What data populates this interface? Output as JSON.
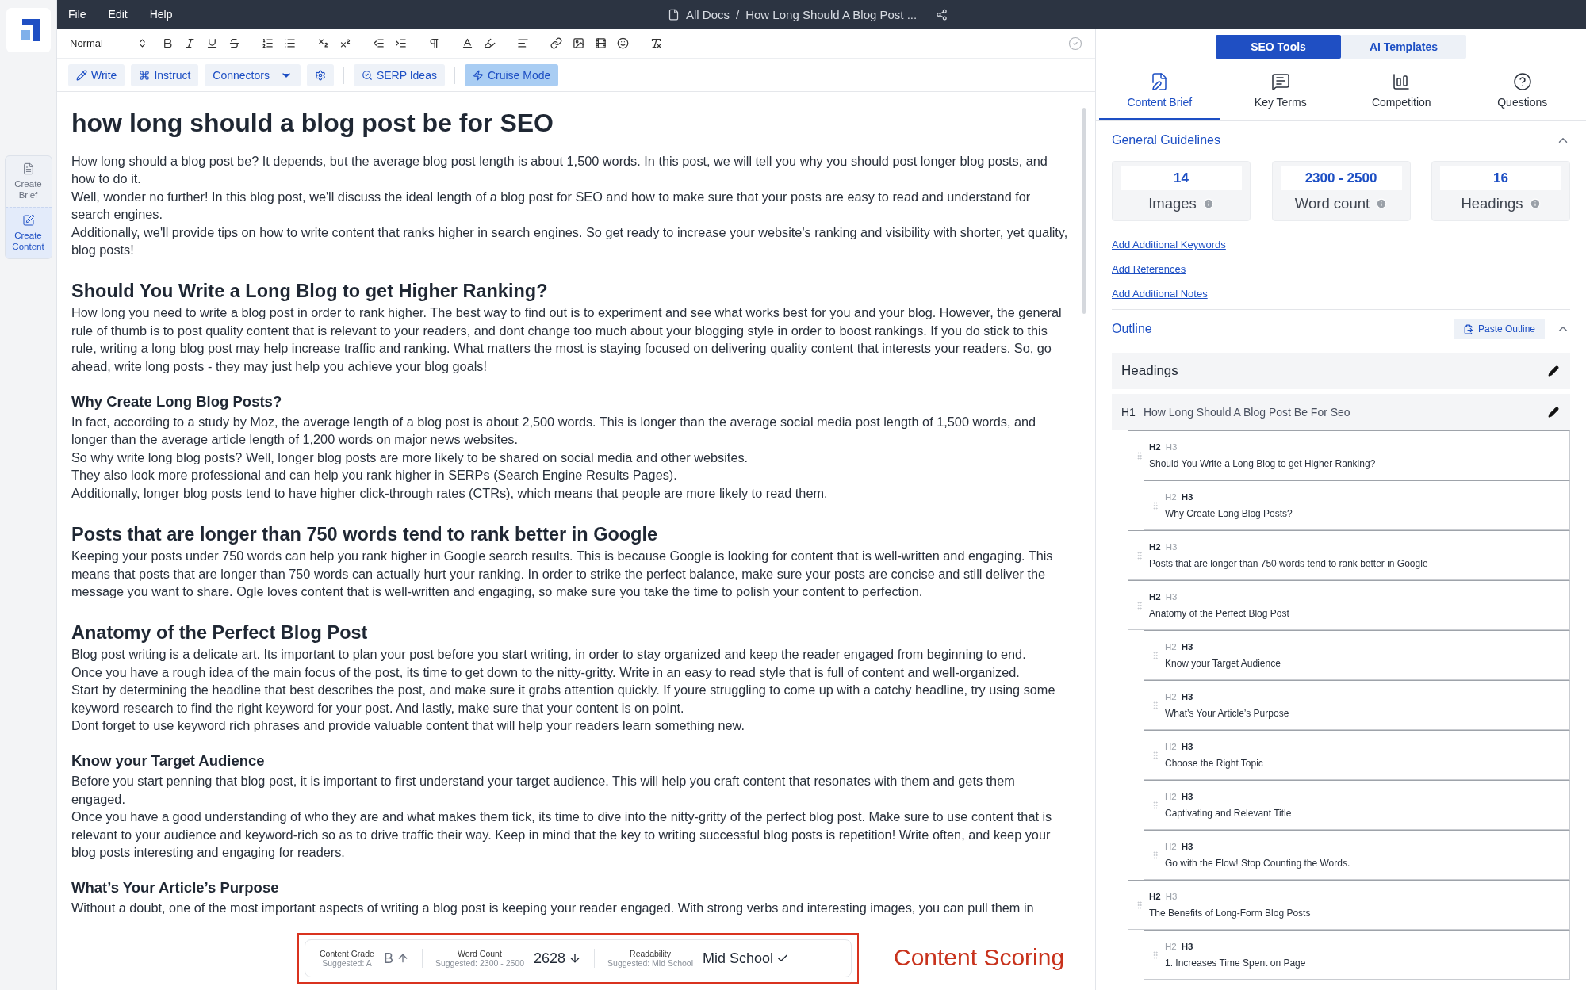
{
  "sidebar": {
    "items": [
      {
        "label": "Create Brief",
        "selected": false
      },
      {
        "label": "Create Content",
        "selected": true
      }
    ]
  },
  "menu": [
    "File",
    "Edit",
    "Help"
  ],
  "breadcrumb": {
    "root": "All Docs",
    "separator": "/",
    "title": "How Long Should A Blog Post ..."
  },
  "toolbar": {
    "style_select": "Normal"
  },
  "actions": [
    {
      "kind": "write",
      "label": "Write",
      "active": false
    },
    {
      "kind": "instruct",
      "label": "Instruct",
      "active": false
    },
    {
      "kind": "connectors",
      "label": "Connectors",
      "active": false
    },
    {
      "kind": "settings",
      "active": false
    },
    {
      "kind": "serp",
      "label": "SERP Ideas",
      "active": false
    },
    {
      "kind": "cruise",
      "label": "Cruise Mode",
      "active": true
    }
  ],
  "document": [
    {
      "kind": "title",
      "text": "how long should a blog post be for SEO"
    },
    {
      "kind": "p",
      "text": "How long should a blog post be? It depends, but the average blog post length is about 1,500 words. In this post, we will tell you why you should post longer blog posts, and how to do it."
    },
    {
      "kind": "p",
      "text": "Well, wonder no further! In this blog post, we'll discuss the ideal length of a blog post for SEO and how to make sure that your posts are easy to read and understand for search engines."
    },
    {
      "kind": "p",
      "text": "Additionally, we'll provide tips on how to write content that ranks higher in search engines. So get ready to increase your website's ranking and visibility with shorter, yet quality, blog posts!"
    },
    {
      "kind": "h2",
      "text": "Should You Write a Long Blog to get Higher Ranking?"
    },
    {
      "kind": "p",
      "text": "How long you need to write a blog post in order to rank higher. The best way to find out is to experiment and see what works best for you and your blog. However, the general rule of thumb is to post quality content that is relevant to your readers, and dont change too much about your blogging style in order to boost rankings. If you do stick to this rule, writing a long blog post may help increase traffic and ranking. What matters the most is staying focused on delivering quality content that interests your readers. So, go ahead, write long posts - they may just help you achieve your blog goals!"
    },
    {
      "kind": "h3",
      "text": "Why Create Long Blog Posts?"
    },
    {
      "kind": "p",
      "text": "In fact, according to a study by Moz, the average length of a blog post is about 2,500 words. This is longer than the average social media post length of 1,500 words, and longer than the average article length of 1,200 words on major news websites."
    },
    {
      "kind": "p",
      "text": "So why write long blog posts? Well, longer blog posts are more likely to be shared on social media and other websites."
    },
    {
      "kind": "p",
      "text": "They also look more professional and can help you rank higher in SERPs (Search Engine Results Pages)."
    },
    {
      "kind": "p",
      "text": "Additionally, longer blog posts tend to have higher click-through rates (CTRs), which means that people are more likely to read them."
    },
    {
      "kind": "h2",
      "text": "Posts that are longer than 750 words tend to rank better in Google"
    },
    {
      "kind": "p",
      "text": "Keeping your posts under 750 words can help you rank higher in Google search results. This is because Google is looking for content that is well-written and engaging. This means that posts that are longer than 750 words can actually hurt your ranking. In order to strike the perfect balance, make sure your posts are concise and still deliver the message you want to share. Ogle loves content that is well-written and engaging, so make sure you take the time to polish your content to perfection."
    },
    {
      "kind": "h2",
      "text": "Anatomy of the Perfect Blog Post"
    },
    {
      "kind": "p",
      "text": "Blog post writing is a delicate art. Its important to plan your post before you start writing, in order to stay organized and keep the reader engaged from beginning to end."
    },
    {
      "kind": "p",
      "text": "Once you have a rough idea of the main focus of the post, its time to get down to the nitty-gritty. Write in an easy to read style that is full of content and well-organized."
    },
    {
      "kind": "p",
      "text": "Start by determining the headline that best describes the post, and make sure it grabs attention quickly. If youre struggling to come up with a catchy headline, try using some keyword research to find the right keyword for your post. And lastly, make sure that your content is on point."
    },
    {
      "kind": "p",
      "text": "Dont forget to use keyword rich phrases and provide valuable content that will help your readers learn something new."
    },
    {
      "kind": "h3",
      "text": "Know your Target Audience"
    },
    {
      "kind": "p",
      "text": "Before you start penning that blog post, it is important to first understand your target audience. This will help you craft content that resonates with them and gets them engaged."
    },
    {
      "kind": "p",
      "text": "Once you have a good understanding of who they are and what makes them tick, its time to dive into the nitty-gritty of the perfect blog post. Make sure to use content that is relevant to your audience and keyword-rich so as to drive traffic their way. Keep in mind that the key to writing successful blog posts is repetition! Write often, and keep your blog posts interesting and engaging for readers."
    },
    {
      "kind": "h3",
      "text": "What’s Your Article’s Purpose"
    },
    {
      "kind": "p",
      "text": "Without a doubt, one of the most important aspects of writing a blog post is keeping your reader engaged. With strong verbs and interesting images, you can pull them in"
    }
  ],
  "scoring": [
    {
      "kind": "up",
      "label": "Content Grade",
      "suggested": "Suggested: A",
      "value": "B"
    },
    {
      "kind": "down",
      "label": "Word Count",
      "suggested": "Suggested: 2300 - 2500",
      "value": "2628"
    },
    {
      "kind": "check",
      "label": "Readability",
      "suggested": "Suggested: Mid School",
      "value": "Mid School"
    }
  ],
  "annotation": "Content Scoring",
  "panel": {
    "modes": [
      {
        "label": "SEO Tools",
        "selected": true
      },
      {
        "label": "AI Templates",
        "selected": false
      }
    ],
    "tabs": [
      {
        "label": "Content Brief",
        "selected": true
      },
      {
        "label": "Key Terms",
        "selected": false
      },
      {
        "label": "Competition",
        "selected": false
      },
      {
        "label": "Questions",
        "selected": false
      }
    ],
    "guidelines": {
      "title": "General Guidelines",
      "expanded": true,
      "stats": [
        {
          "value": "14",
          "label": "Images"
        },
        {
          "value": "2300 - 2500",
          "label": "Word count"
        },
        {
          "value": "16",
          "label": "Headings"
        }
      ],
      "links": [
        "Add Additional Keywords",
        "Add References",
        "Add Additional Notes"
      ]
    },
    "outline": {
      "title": "Outline",
      "paste_button": "Paste Outline",
      "expanded": true,
      "headings_label": "Headings",
      "h1_tag": "H1",
      "h1": "How Long Should A Blog Post Be For Seo",
      "items": [
        {
          "tags": [
            {
              "label": "H2",
              "selected": true
            },
            {
              "label": "H3",
              "selected": false
            }
          ],
          "text": "Should You Write a Long Blog to get Higher Ranking?"
        },
        {
          "tags": [
            {
              "label": "H2",
              "selected": false
            },
            {
              "label": "H3",
              "selected": true
            }
          ],
          "text": "Why Create Long Blog Posts?"
        },
        {
          "tags": [
            {
              "label": "H2",
              "selected": true
            },
            {
              "label": "H3",
              "selected": false
            }
          ],
          "text": "Posts that are longer than 750 words tend to rank better in Google"
        },
        {
          "tags": [
            {
              "label": "H2",
              "selected": true
            },
            {
              "label": "H3",
              "selected": false
            }
          ],
          "text": "Anatomy of the Perfect Blog Post"
        },
        {
          "tags": [
            {
              "label": "H2",
              "selected": false
            },
            {
              "label": "H3",
              "selected": true
            }
          ],
          "text": "Know your Target Audience"
        },
        {
          "tags": [
            {
              "label": "H2",
              "selected": false
            },
            {
              "label": "H3",
              "selected": true
            }
          ],
          "text": "What’s Your Article’s Purpose"
        },
        {
          "tags": [
            {
              "label": "H2",
              "selected": false
            },
            {
              "label": "H3",
              "selected": true
            }
          ],
          "text": "Choose the Right Topic"
        },
        {
          "tags": [
            {
              "label": "H2",
              "selected": false
            },
            {
              "label": "H3",
              "selected": true
            }
          ],
          "text": "Captivating and Relevant Title"
        },
        {
          "tags": [
            {
              "label": "H2",
              "selected": false
            },
            {
              "label": "H3",
              "selected": true
            }
          ],
          "text": "Go with the Flow! Stop Counting the Words."
        },
        {
          "tags": [
            {
              "label": "H2",
              "selected": true
            },
            {
              "label": "H3",
              "selected": false
            }
          ],
          "text": "The Benefits of Long-Form Blog Posts"
        },
        {
          "tags": [
            {
              "label": "H2",
              "selected": false
            },
            {
              "label": "H3",
              "selected": true
            }
          ],
          "text": "1. Increases Time Spent on Page"
        }
      ]
    }
  }
}
